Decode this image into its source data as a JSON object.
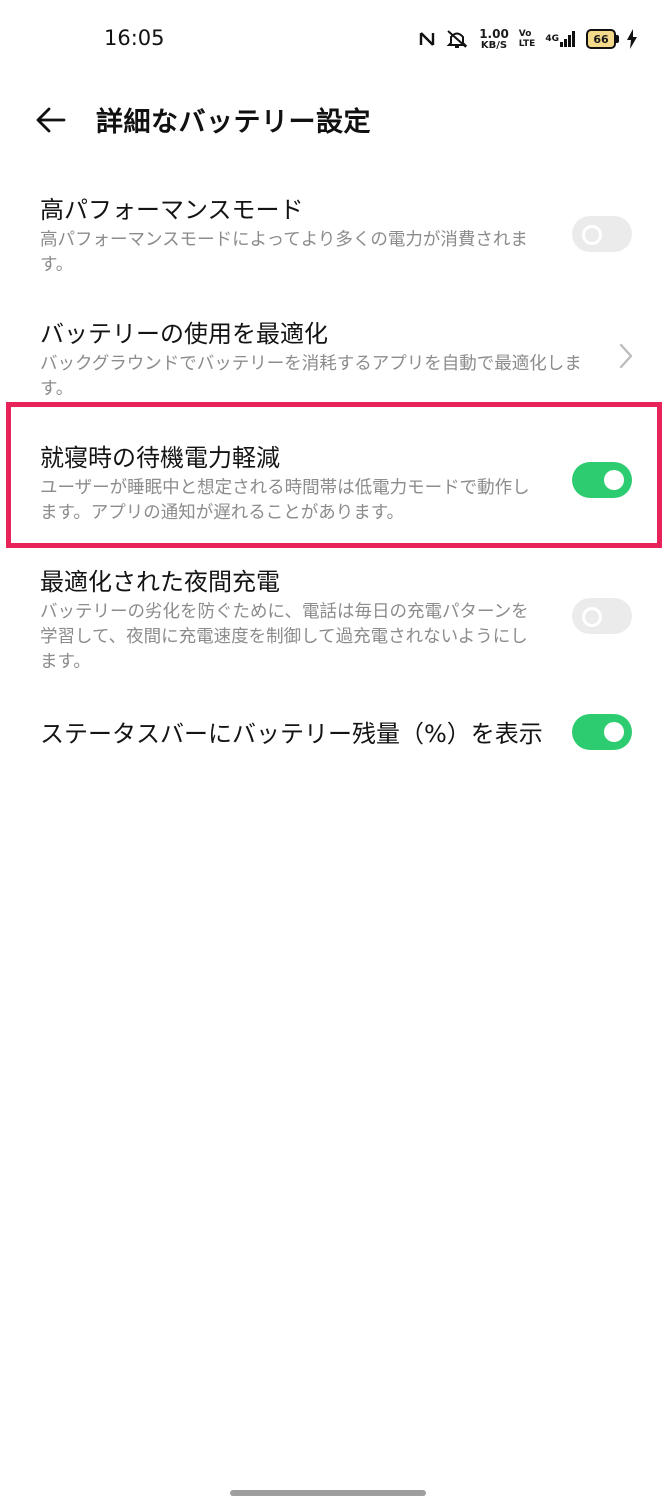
{
  "status_bar": {
    "time": "16:05",
    "net_speed_value": "1.00",
    "net_speed_unit": "KB/S",
    "volte_top": "Vo",
    "volte_bottom": "LTE",
    "network": "4G",
    "battery": "66",
    "icons": [
      "nfc-icon",
      "mute-icon",
      "signal-icon",
      "charging-icon"
    ]
  },
  "header": {
    "title": "詳細なバッテリー設定",
    "back_icon": "back-arrow-icon"
  },
  "settings": [
    {
      "title": "高パフォーマンスモード",
      "description": "高パフォーマンスモードによってより多くの電力が消費されます。",
      "control": "toggle",
      "state": "off"
    },
    {
      "title": "バッテリーの使用を最適化",
      "description": "バックグラウンドでバッテリーを消耗するアプリを自動で最適化します。",
      "control": "chevron"
    },
    {
      "title": "就寝時の待機電力軽減",
      "description": "ユーザーが睡眠中と想定される時間帯は低電力モードで動作します。アプリの通知が遅れることがあります。",
      "control": "toggle",
      "state": "on",
      "highlighted": true
    },
    {
      "title": "最適化された夜間充電",
      "description": "バッテリーの劣化を防ぐために、電話は毎日の充電パターンを学習して、夜間に充電速度を制御して過充電されないようにします。",
      "control": "toggle",
      "state": "off"
    },
    {
      "title": "ステータスバーにバッテリー残量（%）を表示",
      "description": "",
      "control": "toggle",
      "state": "on"
    }
  ],
  "colors": {
    "toggle_on": "#2ecc71",
    "toggle_off": "#ebebeb",
    "highlight_border": "#e8235a",
    "battery_fill": "#f3d98a"
  }
}
